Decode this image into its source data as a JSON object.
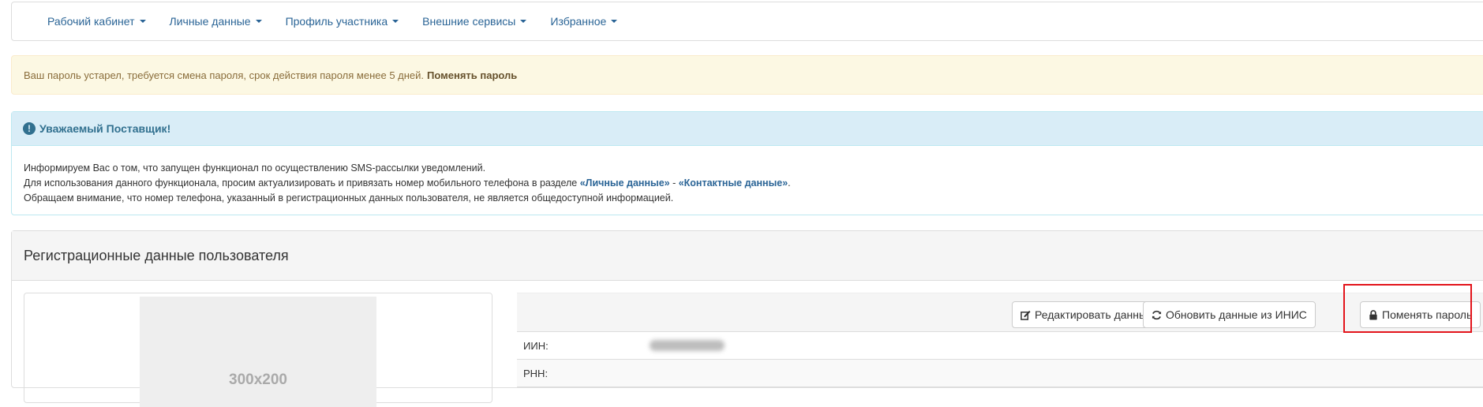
{
  "nav": {
    "items": [
      {
        "label": "Рабочий кабинет"
      },
      {
        "label": "Личные данные"
      },
      {
        "label": "Профиль участника"
      },
      {
        "label": "Внешние сервисы"
      },
      {
        "label": "Избранное"
      }
    ]
  },
  "password_alert": {
    "text": "Ваш пароль устарел, требуется смена пароля, срок действия пароля менее 5 дней.",
    "link": "Поменять пароль"
  },
  "info_panel": {
    "title": "Уважаемый Поставщик!",
    "line1": "Информируем Вас о том, что запущен функционал по осуществлению SMS-рассылки уведомлений.",
    "line2_prefix": "Для использования данного функционала, просим актуализировать и привязать номер мобильного телефона в разделе ",
    "link1": "«Личные данные»",
    "separator": " - ",
    "link2": "«Контактные данные»",
    "line2_suffix": ".",
    "line3": "Обращаем внимание, что номер телефона, указанный в регистрационных данных пользователя, не является общедоступной информацией."
  },
  "registration": {
    "title": "Регистрационные данные пользователя",
    "photo_placeholder": "300x200",
    "buttons": {
      "edit": "Редактировать данные",
      "refresh": "Обновить данные из ИНИС",
      "change_password": "Поменять пароль"
    },
    "fields": [
      {
        "label": "ИИН:"
      },
      {
        "label": "РНН:"
      }
    ]
  },
  "colors": {
    "link": "#2a6496",
    "highlight": "#e3141b"
  }
}
